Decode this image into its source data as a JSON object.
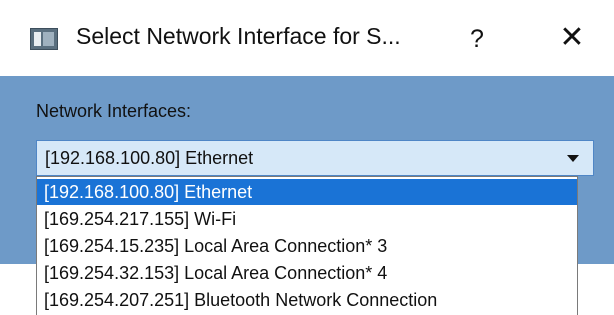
{
  "window": {
    "title": "Select Network Interface for S...",
    "help_label": "?",
    "close_label": "✕"
  },
  "form": {
    "label": "Network Interfaces:",
    "selected_value": "[192.168.100.80] Ethernet"
  },
  "dropdown": {
    "options": [
      "[192.168.100.80] Ethernet",
      "[169.254.217.155] Wi-Fi",
      "[169.254.15.235] Local Area Connection* 3",
      "[169.254.32.153] Local Area Connection* 4",
      "[169.254.207.251] Bluetooth Network Connection"
    ],
    "highlighted_option": "[192.168.100.80] Ethernet"
  },
  "colors": {
    "dialog_body": "#6e9ac8",
    "combo_background": "#d6e8f8",
    "highlight": "#1a73d6"
  },
  "icons": {
    "app": "window-app-icon",
    "help": "help-icon",
    "close": "close-icon",
    "dropdown": "chevron-down-icon"
  }
}
